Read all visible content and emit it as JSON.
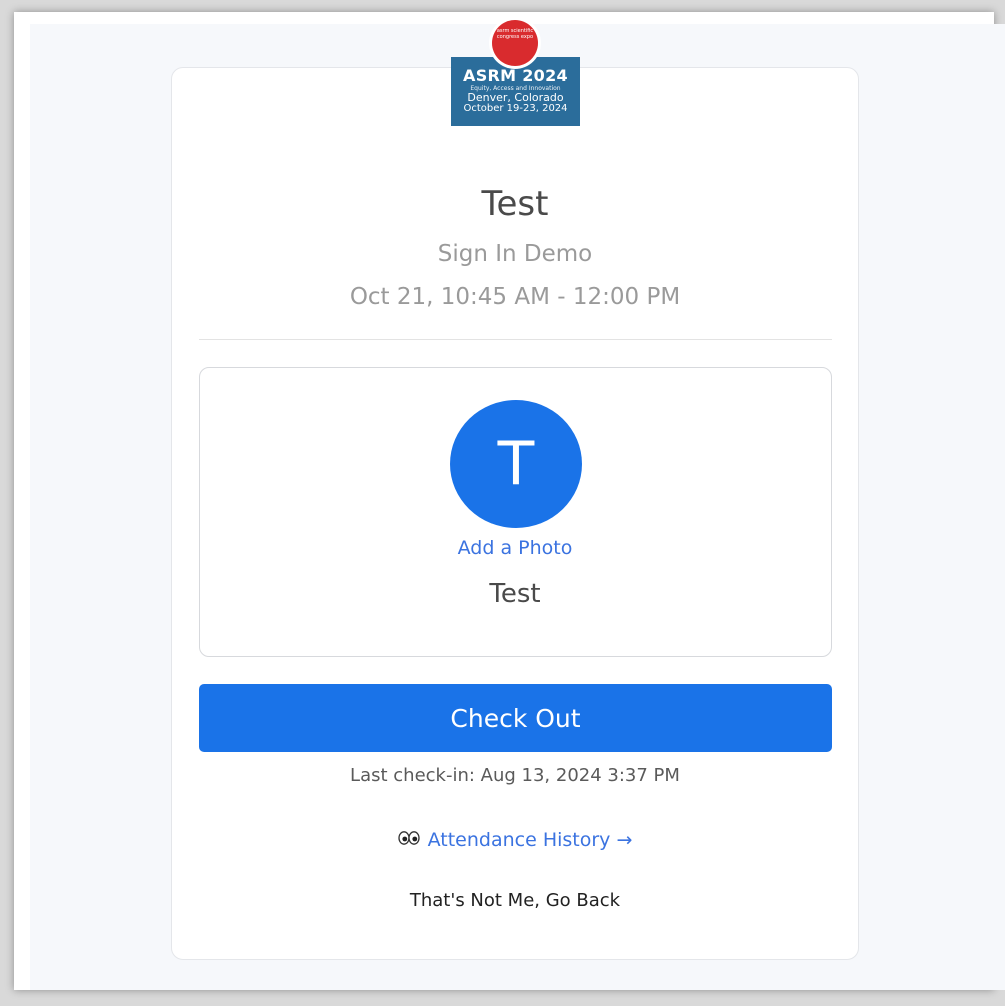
{
  "event": {
    "logo_badge_text": "asrm scientific congress expo",
    "logo_title": "ASRM 2024",
    "logo_tagline": "Equity, Access and Innovation",
    "logo_location": "Denver, Colorado",
    "logo_dates": "October 19-23, 2024"
  },
  "session": {
    "title": "Test",
    "subtitle": "Sign In Demo",
    "time": "Oct 21, 10:45 AM - 12:00 PM"
  },
  "profile": {
    "avatar_initial": "T",
    "add_photo_label": "Add a Photo",
    "name": "Test"
  },
  "actions": {
    "checkout_label": "Check Out",
    "last_checkin": "Last check-in: Aug 13, 2024 3:37 PM",
    "attendance_label": "Attendance History →",
    "go_back_label": "That's Not Me, Go Back"
  },
  "colors": {
    "primary": "#1a73e8",
    "link": "#3b73e0",
    "logo_blue": "#2b6d9b",
    "logo_red": "#d92b2e"
  },
  "icons": {
    "attendance": "eyes-icon"
  }
}
